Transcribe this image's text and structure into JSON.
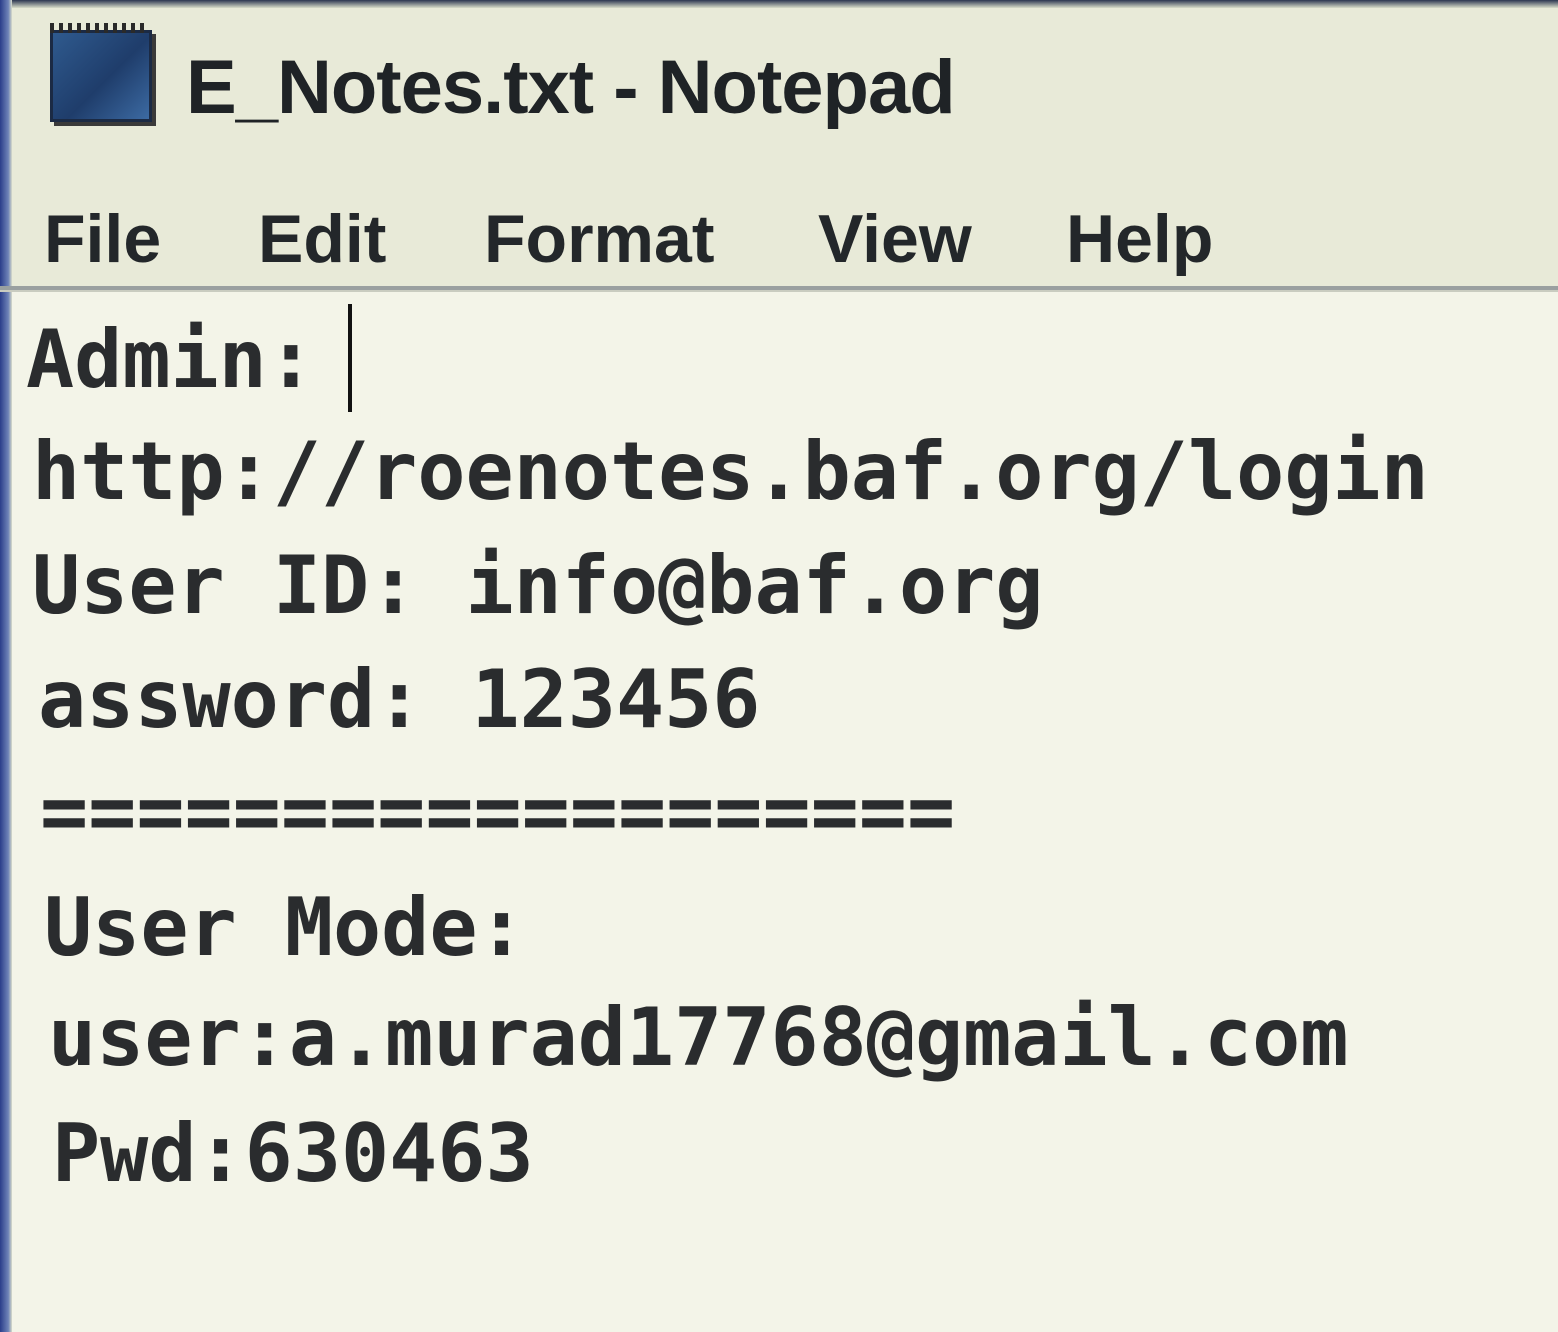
{
  "window": {
    "title": "E_Notes.txt - Notepad",
    "app_icon": "notepad-icon"
  },
  "menu": {
    "file": "File",
    "edit": "Edit",
    "format": "Format",
    "view": "View",
    "help": "Help"
  },
  "editor": {
    "lines": [
      "Admin:",
      "http://roenotes.baf.org/login",
      "User ID: info@baf.org",
      "assword: 123456",
      "===================",
      "User Mode:",
      "user:a.murad17768@gmail.com",
      "Pwd:630463"
    ]
  }
}
